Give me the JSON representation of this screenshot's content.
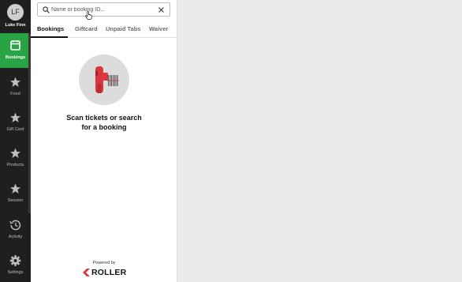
{
  "user": {
    "initials": "LF",
    "name": "Luke Finn"
  },
  "nav": [
    {
      "label": "Bookings",
      "icon": "calendar-icon",
      "active": true
    },
    {
      "label": "Food",
      "icon": "star-icon"
    },
    {
      "label": "Gift Card",
      "icon": "star-icon"
    },
    {
      "label": "Products",
      "icon": "star-icon"
    },
    {
      "label": "Session",
      "icon": "star-icon"
    },
    {
      "label": "Activity",
      "icon": "history-icon"
    },
    {
      "label": "Settings",
      "icon": "gear-icon"
    }
  ],
  "search": {
    "placeholder": "Name or booking ID...",
    "value": ""
  },
  "tabs": [
    "Bookings",
    "Giftcard",
    "Unpaid Tabs",
    "Waiver"
  ],
  "active_tab": "Bookings",
  "empty_state": {
    "line1": "Scan tickets or search",
    "line2": "for a booking",
    "icon": "barcode-scanner-icon"
  },
  "footer": {
    "powered_by": "Powered by",
    "brand": "ROLLER"
  },
  "colors": {
    "rail": "#1f1f1f",
    "accent": "#29a343",
    "scanner": "#d9363e"
  }
}
